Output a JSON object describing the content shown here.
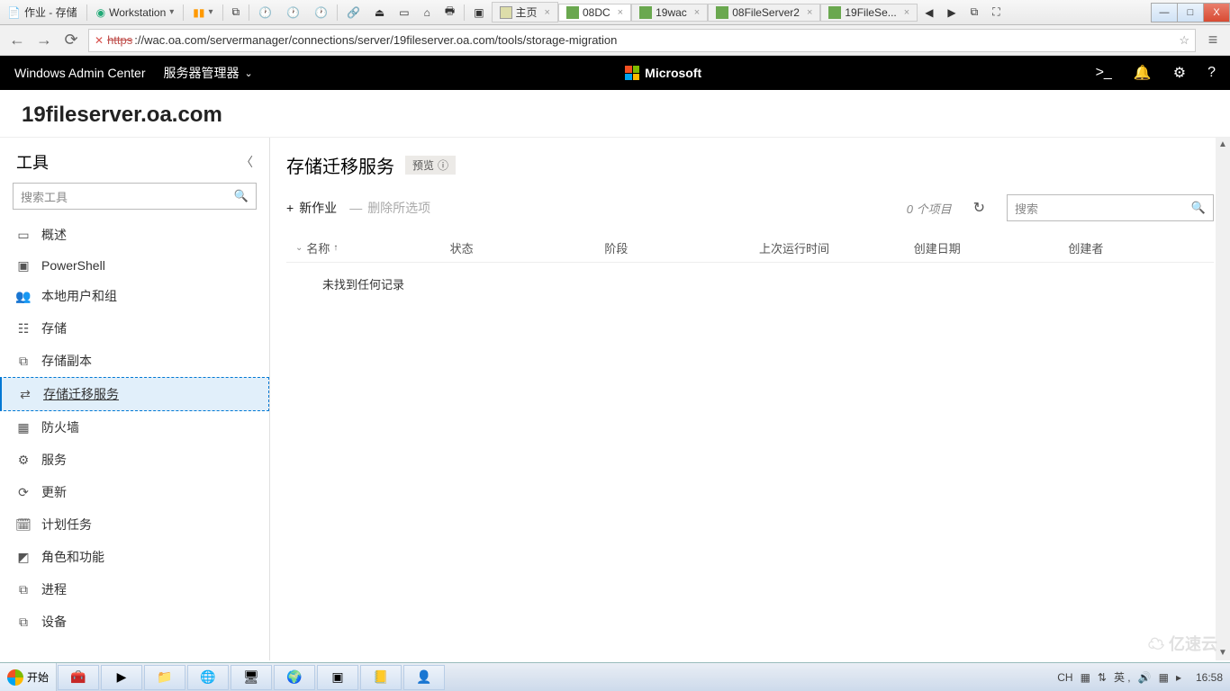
{
  "vmware": {
    "app_menu": "作业 - 存储",
    "workstation": "Workstation",
    "tabs": [
      {
        "label": "主页",
        "kind": "home"
      },
      {
        "label": "08DC",
        "kind": "srv",
        "active": true
      },
      {
        "label": "19wac",
        "kind": "srv"
      },
      {
        "label": "08FileServer2",
        "kind": "srv"
      },
      {
        "label": "19FileSe...",
        "kind": "srv"
      }
    ],
    "win_min": "—",
    "win_max": "□",
    "win_close": "X"
  },
  "browser": {
    "back": "←",
    "forward": "→",
    "reload": "⟳",
    "lock": "✕",
    "url_prefix": "https",
    "url": "://wac.oa.com/servermanager/connections/server/19fileserver.oa.com/tools/storage-migration",
    "star": "☆",
    "menu": "≡"
  },
  "wac": {
    "brand": "Windows Admin Center",
    "context": "服务器管理器",
    "ms": "Microsoft",
    "icons": {
      "shell": ">_",
      "bell": "🔔",
      "gear": "⚙",
      "help": "?"
    }
  },
  "server": "19fileserver.oa.com",
  "sidebar": {
    "title": "工具",
    "collapse": "〈",
    "search_ph": "搜索工具",
    "items": [
      {
        "icon": "▭",
        "label": "概述"
      },
      {
        "icon": "▣",
        "label": "PowerShell"
      },
      {
        "icon": "👥",
        "label": "本地用户和组"
      },
      {
        "icon": "☷",
        "label": "存储"
      },
      {
        "icon": "⧉",
        "label": "存储副本"
      },
      {
        "icon": "⇄",
        "label": "存储迁移服务",
        "active": true
      },
      {
        "icon": "▦",
        "label": "防火墙"
      },
      {
        "icon": "⚙",
        "label": "服务"
      },
      {
        "icon": "⟳",
        "label": "更新"
      },
      {
        "icon": "🗓",
        "label": "计划任务"
      },
      {
        "icon": "◩",
        "label": "角色和功能"
      },
      {
        "icon": "⧉",
        "label": "进程"
      },
      {
        "icon": "⧉",
        "label": "设备"
      }
    ]
  },
  "content": {
    "title": "存储迁移服务",
    "badge": "预览",
    "badge_icon": "ⓘ",
    "new_job": "新作业",
    "new_job_icon": "+",
    "delete": "删除所选项",
    "delete_icon": "—",
    "count": "0 个项目",
    "refresh": "↻",
    "search_ph": "搜索",
    "columns": [
      "名称",
      "状态",
      "阶段",
      "上次运行时间",
      "创建日期",
      "创建者"
    ],
    "sort_icon": "↑",
    "chevron": "⌄",
    "empty": "未找到任何记录"
  },
  "taskbar": {
    "start": "开始",
    "apps": [
      "🧰",
      "▶",
      "📁",
      "🌐",
      "🖥",
      "🌍",
      "▣",
      "📒",
      "👤"
    ],
    "tray": {
      "ime": "CH",
      "sec": "▦",
      "net": "⇅",
      "lang": "英 ,",
      "snd": "🔊",
      "flag": "▦",
      "more": "▸"
    },
    "clock": "16:58"
  },
  "watermark": "亿速云"
}
